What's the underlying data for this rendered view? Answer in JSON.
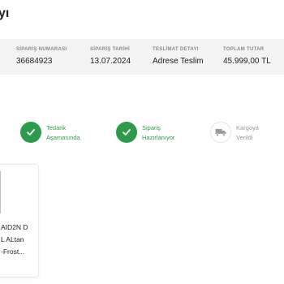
{
  "header": {
    "title": "yı"
  },
  "summary": [
    {
      "label": "SİPARİŞ NUMARASI",
      "value": "36684923"
    },
    {
      "label": "SİPARİŞ TARİHİ",
      "value": "13.07.2024"
    },
    {
      "label": "TESLİMAT DETAYI",
      "value": "Adrese Teslim"
    },
    {
      "label": "TOPLAM TUTAR",
      "value": "45.999,00 TL"
    }
  ],
  "steps": [
    {
      "line1": "Tedarik",
      "line2": "Aşamasında",
      "status": "done",
      "icon": "check-icon"
    },
    {
      "line1": "Sipariş",
      "line2": "Hazırlanıyor",
      "status": "done",
      "icon": "check-icon"
    },
    {
      "line1": "Kargoya",
      "line2": "Verildi",
      "status": "pending",
      "icon": "truck-icon"
    }
  ],
  "product": {
    "lines": [
      "AID2N D",
      "L ALtan",
      "-Frost..."
    ]
  },
  "colors": {
    "success": "#2c9c4a",
    "summary_bg": "#f3f3f3",
    "muted": "#9a9a9a"
  }
}
